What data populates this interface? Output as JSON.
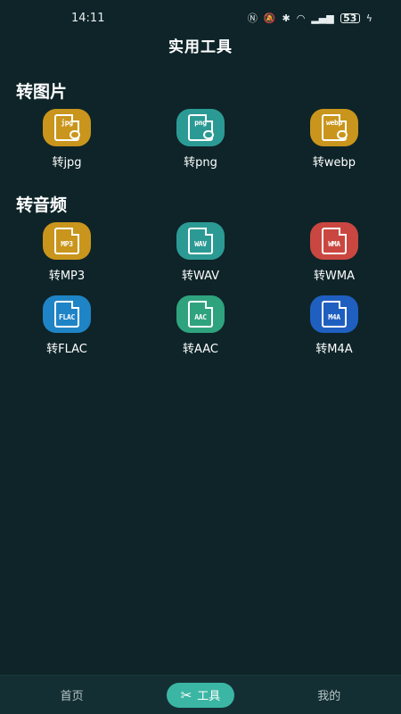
{
  "status_bar": {
    "time": "14:11",
    "battery": "53"
  },
  "page_title": "实用工具",
  "sections": [
    {
      "title": "转图片",
      "tools": [
        {
          "label": "转jpg",
          "icon_text": "jpg",
          "icon": "image-jpg-icon",
          "color": "#c9951c"
        },
        {
          "label": "转png",
          "icon_text": "png",
          "icon": "image-png-icon",
          "color": "#2c9a94"
        },
        {
          "label": "转webp",
          "icon_text": "webp",
          "icon": "image-webp-icon",
          "color": "#c9951c"
        }
      ]
    },
    {
      "title": "转音频",
      "tools": [
        {
          "label": "转MP3",
          "icon_text": "MP3",
          "icon": "audio-mp3-icon",
          "color": "#c9951c"
        },
        {
          "label": "转WAV",
          "icon_text": "WAV",
          "icon": "audio-wav-icon",
          "color": "#2c9a94"
        },
        {
          "label": "转WMA",
          "icon_text": "WMA",
          "icon": "audio-wma-icon",
          "color": "#c94740"
        },
        {
          "label": "转FLAC",
          "icon_text": "FLAC",
          "icon": "audio-flac-icon",
          "color": "#1f84c6"
        },
        {
          "label": "转AAC",
          "icon_text": "AAC",
          "icon": "audio-aac-icon",
          "color": "#2fa37e"
        },
        {
          "label": "转M4A",
          "icon_text": "M4A",
          "icon": "audio-m4a-icon",
          "color": "#1f5fc0"
        }
      ]
    }
  ],
  "bottom_nav": {
    "home_label": "首页",
    "tools_label": "工具",
    "mine_label": "我的",
    "tools_icon": "wrench-icon"
  }
}
